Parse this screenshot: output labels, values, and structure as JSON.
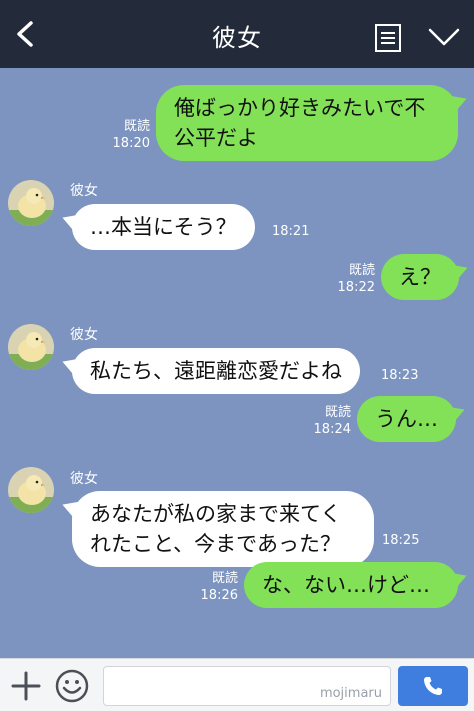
{
  "header": {
    "title": "彼女"
  },
  "messages": [
    {
      "side": "me",
      "text_lines": [
        "俺ばっかり好きみたいで不",
        "公平だよ"
      ],
      "read": "既読",
      "time": "18:20"
    },
    {
      "side": "them",
      "sender": "彼女",
      "text_lines": [
        "…本当にそう？"
      ],
      "time": "18:21"
    },
    {
      "side": "me",
      "text_lines": [
        "え？"
      ],
      "read": "既読",
      "time": "18:22"
    },
    {
      "side": "them",
      "sender": "彼女",
      "text_lines": [
        "私たち、遠距離恋愛だよね"
      ],
      "time": "18:23"
    },
    {
      "side": "me",
      "text_lines": [
        "うん…"
      ],
      "read": "既読",
      "time": "18:24"
    },
    {
      "side": "them",
      "sender": "彼女",
      "text_lines": [
        "あなたが私の家まで来てく",
        "れたこと、今まであった？"
      ],
      "time": "18:25"
    },
    {
      "side": "me",
      "text_lines": [
        "な、ない…けど…"
      ],
      "read": "既読",
      "time": "18:26"
    }
  ],
  "footer": {
    "watermark": "mojimaru"
  },
  "icons": {
    "back": "chevron-left-icon",
    "menu": "list-icon",
    "down": "chevron-down-icon",
    "plus": "plus-icon",
    "emoji": "smiley-icon",
    "call": "phone-icon"
  },
  "colors": {
    "header_bg": "#232a3a",
    "chat_bg": "#7c94bf",
    "my_bubble": "#82e157",
    "their_bubble": "#ffffff",
    "call_button": "#3f7dde"
  }
}
